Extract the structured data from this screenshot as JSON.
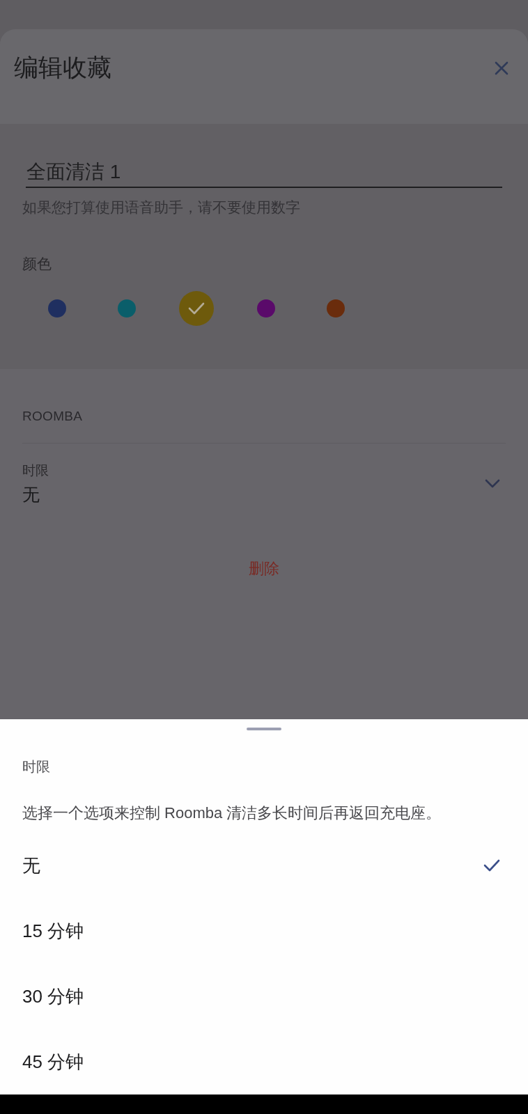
{
  "dialog": {
    "title": "编辑收藏",
    "name_field": {
      "value": "全面清洁 1"
    },
    "helper_text": "如果您打算使用语音助手，请不要使用数字",
    "color_label": "颜色",
    "colors": [
      {
        "color": "#1f2f60",
        "selected": false
      },
      {
        "color": "#0a5e6a",
        "selected": false
      },
      {
        "color": "#6e5a0c",
        "selected": true
      },
      {
        "color": "#5a0a6a",
        "selected": false
      },
      {
        "color": "#6a2c0c",
        "selected": false
      }
    ],
    "section_header": "ROOMBA",
    "time_limit": {
      "label": "时限",
      "value": "无"
    },
    "delete_button": "删除"
  },
  "sheet": {
    "title": "时限",
    "description": "选择一个选项来控制 Roomba 清洁多长时间后再返回充电座。",
    "options": [
      {
        "label": "无",
        "selected": true
      },
      {
        "label": "15 分钟",
        "selected": false
      },
      {
        "label": "30 分钟",
        "selected": false
      },
      {
        "label": "45 分钟",
        "selected": false
      }
    ]
  }
}
